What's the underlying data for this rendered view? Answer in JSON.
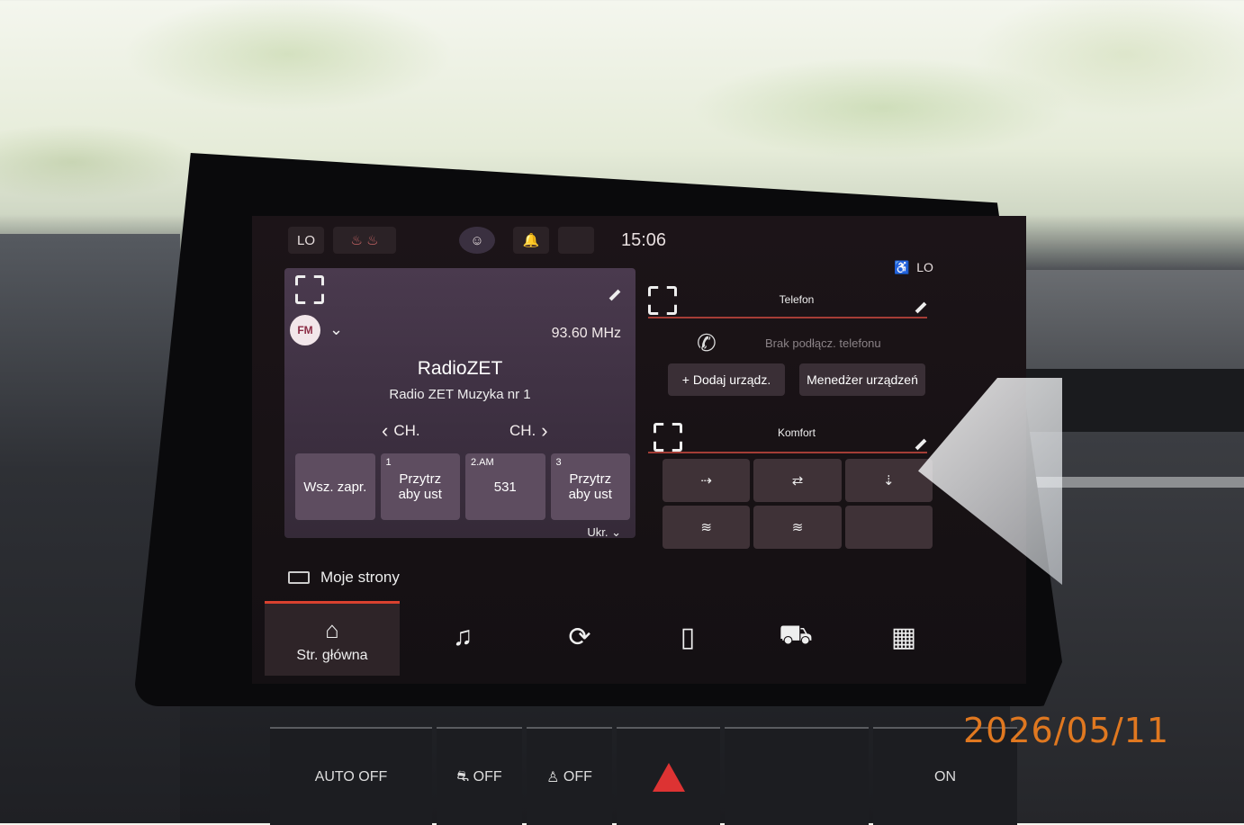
{
  "statusbar": {
    "temp_left": "LO",
    "time": "15:06",
    "temp_right": "LO"
  },
  "radio": {
    "band": "FM",
    "frequency": "93.60 MHz",
    "station": "RadioZET",
    "song": "Radio ZET Muzyka nr 1",
    "prev_label": "CH.",
    "next_label": "CH.",
    "presets": [
      {
        "num": "",
        "label": "Wsz. zapr."
      },
      {
        "num": "1",
        "label": "Przytrz\naby ust"
      },
      {
        "num": "2.AM",
        "label": "531"
      },
      {
        "num": "3",
        "label": "Przytrz\naby ust"
      }
    ],
    "more_label": "Ukr."
  },
  "my_pages": "Moje strony",
  "phone": {
    "title": "Telefon",
    "status": "Brak podłącz. telefonu",
    "add_button": "+ Dodaj urządz.",
    "manager_button": "Menedżer urządzeń"
  },
  "comfort": {
    "title": "Komfort"
  },
  "nav": {
    "home_label": "Str. główna"
  },
  "physical": {
    "auto_off": "AUTO OFF",
    "esc_off": "OFF",
    "seat_off": "OFF",
    "cam_label": "ON"
  },
  "date_stamp": "2026/05/11"
}
